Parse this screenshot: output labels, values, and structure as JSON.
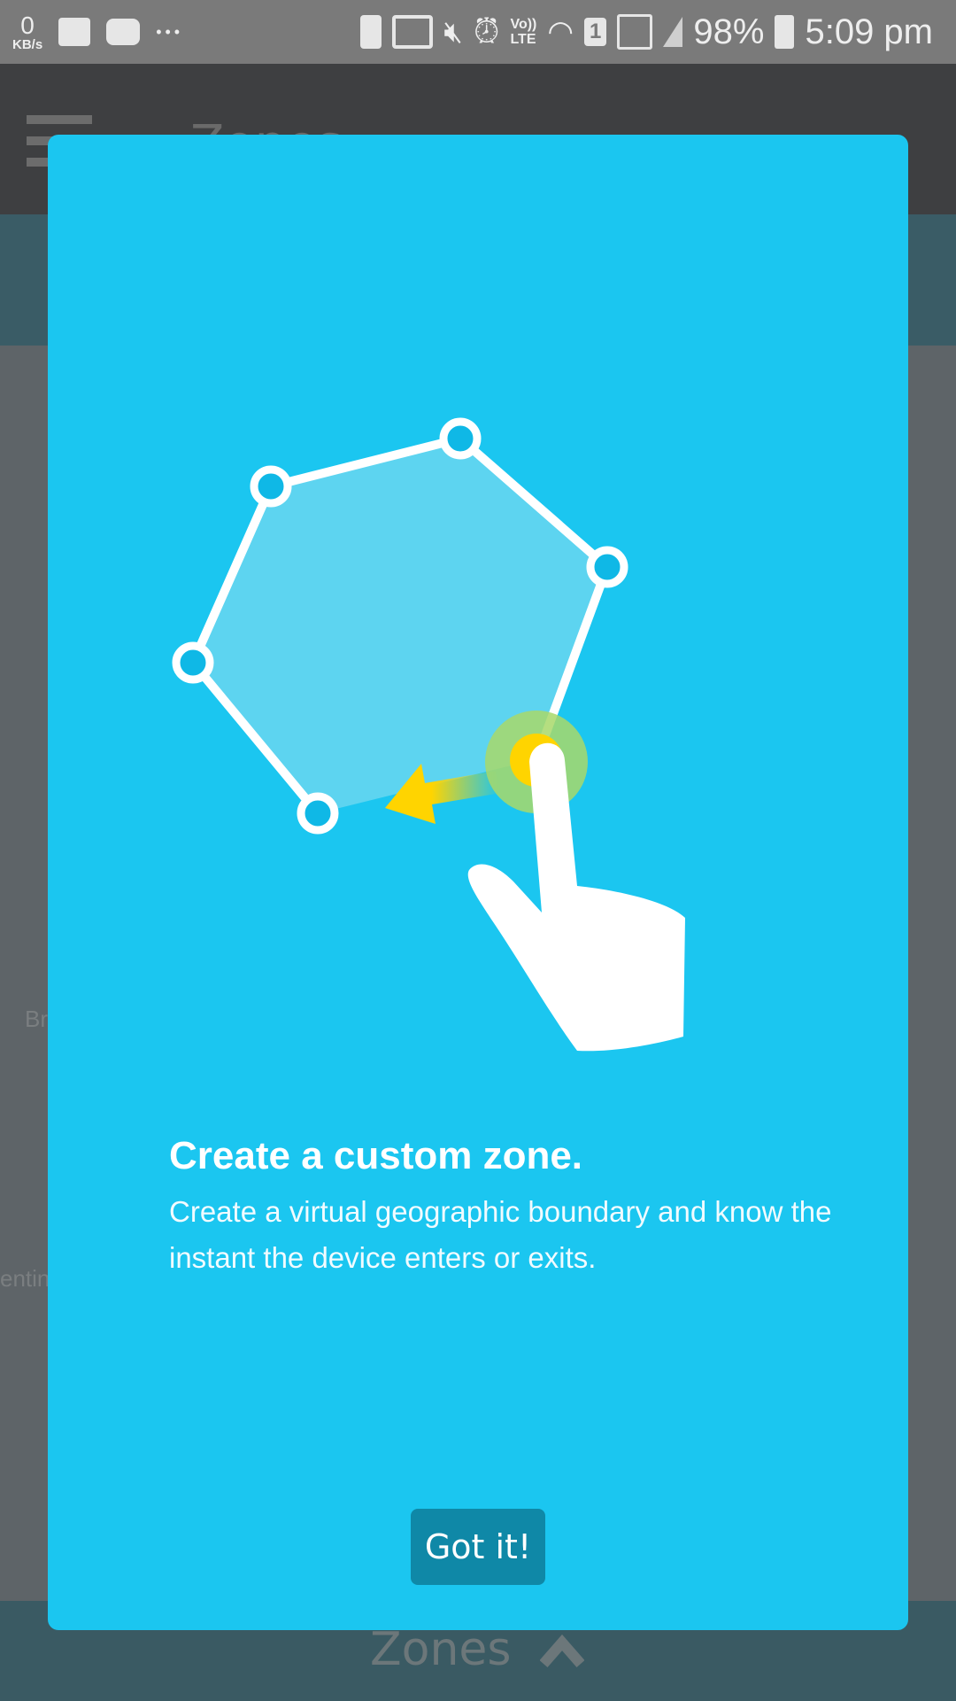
{
  "status_bar": {
    "net_speed": "0",
    "net_unit": "KB/s",
    "more": "•••",
    "sim": "1",
    "volte": "Vo))",
    "lte": "LTE",
    "battery": "98%",
    "time": "5:09 pm",
    "icons": [
      "image-icon",
      "youtube-icon",
      "battery-saver-icon",
      "cast-icon",
      "vibrate-icon",
      "alarm-icon",
      "volte-icon",
      "wifi-icon",
      "sim-icon",
      "signal-icon",
      "battery-icon"
    ]
  },
  "app": {
    "title": "Zones",
    "bottom_sheet_label": "Zones",
    "map_labels": [
      "Br",
      "entin"
    ]
  },
  "dialog": {
    "title": "Create a custom zone.",
    "body": "Create a virtual geographic boundary and know the instant the device enters or exits.",
    "button": "Got it!",
    "colors": {
      "background": "#1bc6f0",
      "button": "#0f88a7",
      "touch": "#ffd400"
    }
  }
}
